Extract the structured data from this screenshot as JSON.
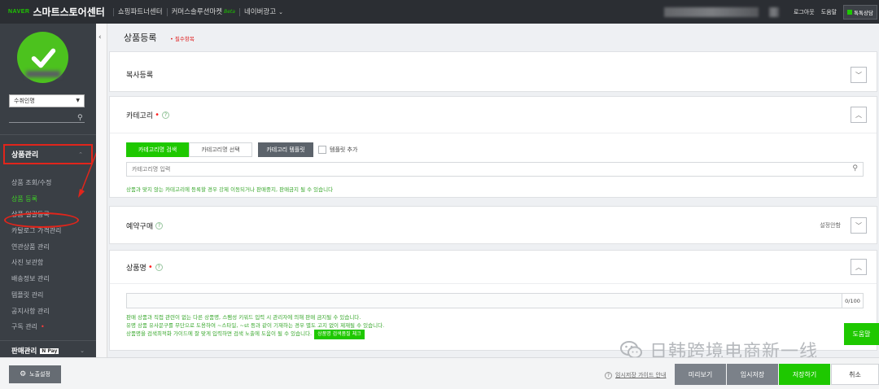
{
  "topbar": {
    "naver": "NAVER",
    "title": "스마트스토어센터",
    "nav": [
      {
        "label": "쇼핑파트너센터"
      },
      {
        "label": "커머스솔루션마켓",
        "badge": "Beta"
      },
      {
        "label": "네이버광고"
      }
    ],
    "logout": "로그아웃",
    "help": "도움말",
    "talk": "톡톡상담"
  },
  "sidebar": {
    "select_value": "수취인명",
    "section_title": "상품관리",
    "menu": [
      {
        "label": "상품 조회/수정"
      },
      {
        "label": "상품 등록"
      },
      {
        "label": "상품 일괄등록"
      },
      {
        "label": "카탈로그 가격관리"
      },
      {
        "label": "연관상품 관리"
      },
      {
        "label": "사진 보관함"
      },
      {
        "label": "배송정보 관리"
      },
      {
        "label": "템플릿 관리"
      },
      {
        "label": "공지사항 관리"
      },
      {
        "label": "구독 관리"
      }
    ],
    "menu_new_dot": "•",
    "section2_title": "판매관리",
    "section2_badge": "N Pay",
    "active_color": "#3ed226"
  },
  "main": {
    "page_title": "상품등록",
    "required_note": "• 필수항목",
    "copy_section": {
      "title": "복사등록"
    },
    "category": {
      "title": "카테고리",
      "tabs": [
        "카테고리명 검색",
        "카테고리명 선택"
      ],
      "template_button": "카테고리 템플릿",
      "template_add": "템플릿 추가",
      "input_placeholder": "카테고리명 입력",
      "note": "상품과 맞지 않는 카테고리에 등록할 경우 강제 이동되거나 판매중지, 판매금지 될 수 있습니다"
    },
    "preorder": {
      "title": "예약구매",
      "status": "설정안함"
    },
    "product_name": {
      "title": "상품명",
      "counter": "0/100",
      "notes": [
        "판매 상품과 직접 관련이 없는 다른 상품명, 스팸성 키워드 입력 시 관리자에 의해 판매 금지될 수 있습니다.",
        "유명 상품 유사문구를 무단으로 도용하여 ~스타일, ~st 등과 같이 기재하는 경우 별도 고지 없이 제재될 수 있습니다.",
        "상품명을 검색최적화 가이드에 잘 맞게 입력하면 검색 노출에 도움이 될 수 있습니다."
      ],
      "check_button": "상품명 검색품질 체크"
    },
    "help_float": "도움말"
  },
  "bottombar": {
    "expose_settings": "노출설정",
    "guide": "임시저장 가이드 안내",
    "preview": "미리보기",
    "temp_save": "임시저장",
    "save": "저장하기",
    "cancel": "취소"
  },
  "watermark": "日韩跨境电商新一线",
  "colors": {
    "naver_green": "#1ec800",
    "annotation_red": "#e1251b",
    "sidebar_bg": "#3a3f45",
    "topbar_bg": "#2b2e33"
  }
}
